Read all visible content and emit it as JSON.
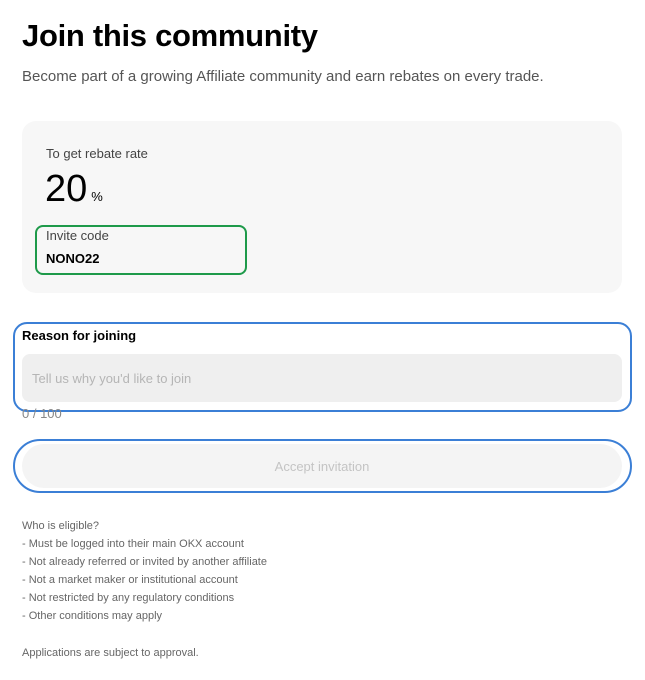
{
  "header": {
    "title": "Join this community",
    "subtitle": "Become part of a growing Affiliate community and earn rebates on every trade."
  },
  "rebate": {
    "label": "To get rebate rate",
    "value": "20",
    "unit": "%"
  },
  "invite": {
    "label": "Invite code",
    "code": "NONO22"
  },
  "reason": {
    "label": "Reason for joining",
    "placeholder": "Tell us why you'd like to join",
    "value": "",
    "char_count": "0 / 100"
  },
  "accept": {
    "label": "Accept invitation"
  },
  "eligibility": {
    "heading": "Who is eligible?",
    "items": [
      "- Must be logged into their main OKX account",
      "- Not already referred or invited by another affiliate",
      "- Not a market maker or institutional account",
      "- Not restricted by any regulatory conditions",
      "- Other conditions may apply"
    ]
  },
  "footer": {
    "approval_note": "Applications are subject to approval."
  },
  "colors": {
    "invite_highlight": "#1e9a4a",
    "form_highlight": "#3b7fd6",
    "card_background": "#f7f7f7"
  }
}
